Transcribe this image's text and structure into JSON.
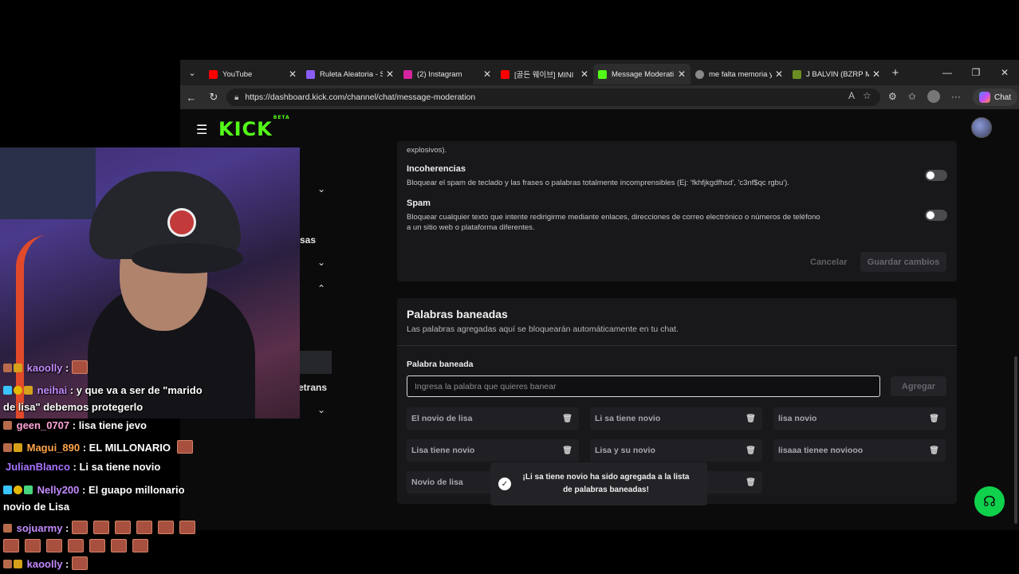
{
  "browser": {
    "tabs": [
      {
        "title": "YouTube",
        "favicon_color": "#ff0000"
      },
      {
        "title": "Ruleta Aleatoria - S",
        "favicon_color": "#8a5cf6"
      },
      {
        "title": "(2) Instagram",
        "favicon_color": "#d6249f"
      },
      {
        "title": "[골든 웨이브] MINI",
        "favicon_color": "#ff0000"
      },
      {
        "title": "Message Moderati",
        "favicon_color": "#53fc18"
      },
      {
        "title": "me falta memoria y",
        "favicon_color": "#888888"
      },
      {
        "title": "J BALVIN (BZRP Mu",
        "favicon_color": "#6b8e23"
      }
    ],
    "url": "https://dashboard.kick.com/channel/chat/message-moderation",
    "chat_label": "Chat"
  },
  "kick": {
    "logo": "KICK",
    "logo_badge": "BETA",
    "sidebar": {
      "partial_label_1": "sas",
      "partial_label_2": "etrans"
    }
  },
  "moderation": {
    "cut_text": "explosivos).",
    "settings": [
      {
        "title": "Incoherencias",
        "description": "Bloquear el spam de teclado y las frases o palabras totalmente incomprensibles (Ej: 'fkhfjkgdfhsd', 'c3nf$qc rgbu')."
      },
      {
        "title": "Spam",
        "description": "Bloquear cualquier texto que intente redirigirme mediante enlaces, direcciones de correo electrónico o números de teléfono a un sitio web o plataforma diferentes."
      }
    ],
    "cancel_label": "Cancelar",
    "save_label": "Guardar cambios"
  },
  "banned_words": {
    "title": "Palabras baneadas",
    "subtitle": "Las palabras agregadas aquí se bloquearán automáticamente en tu chat.",
    "field_label": "Palabra baneada",
    "placeholder": "Ingresa la palabra que quieres banear",
    "add_label": "Agregar",
    "words": [
      "El novio de lisa",
      "Li sa tiene novio",
      "lisa novio",
      "Lisa tiene novio",
      "Lisa y su novio",
      "lisaaa tienee noviooo",
      "Novio de lisa",
      ""
    ]
  },
  "toast": {
    "message": "¡Li sa tiene novio ha sido agregada a la lista de palabras baneadas!"
  },
  "stream_chat": [
    {
      "user": "kaoolly",
      "sep": " :",
      "text": "",
      "user_color": "#c48bff"
    },
    {
      "user": "neihai",
      "sep": " :",
      "text": " y que va a ser de \"marido",
      "text2": "de lisa\" debemos protegerlo",
      "user_color": "#c48bff"
    },
    {
      "user": "geen_0707",
      "sep": " :",
      "text": " lisa tiene jevo",
      "user_color": "#ffa4d8"
    },
    {
      "user": "Magui_890",
      "sep": " :",
      "text": " EL MILLONARIO",
      "user_color": "#ffa449"
    },
    {
      "user": "JulianBlanco",
      "sep": " :",
      "text": " Li sa tiene novio",
      "user_color": "#a873ff"
    },
    {
      "user": "Nelly200",
      "sep": " :",
      "text": " El guapo millonario",
      "text2": "novio de Lisa",
      "user_color": "#c48bff"
    },
    {
      "user": "sojuarmy",
      "sep": " :",
      "text": "",
      "user_color": "#c48bff"
    },
    {
      "user": "kaoolly",
      "sep": " :",
      "text": "",
      "user_color": "#c48bff"
    }
  ]
}
